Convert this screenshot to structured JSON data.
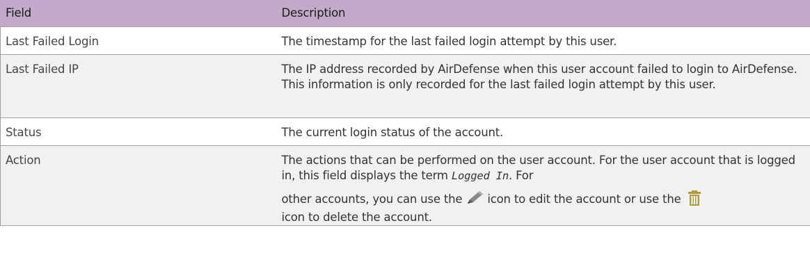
{
  "table": {
    "headers": [
      "Field",
      "Description"
    ],
    "rows": [
      {
        "field": "Last Failed Login",
        "description": "The timestamp for the last failed login attempt by this user."
      },
      {
        "field": "Last Failed IP",
        "description": "The IP address recorded by AirDefense when this user account failed to login to AirDefense. This information is only recorded for the last failed login attempt by this user."
      },
      {
        "field": "Status",
        "description": "The current login status of the account."
      },
      {
        "field": "Action",
        "description_part1": "The actions that can be performed on the user account. For the user account that is logged in, this field displays the term ",
        "term": "Logged In",
        "description_part2": ". For",
        "description_part3": "other accounts, you can use the ",
        "edit_icon": "pencil-icon",
        "description_part4": " icon to edit the account or use the ",
        "delete_icon": "trash-icon",
        "description_part5": "icon to delete the account."
      }
    ]
  },
  "colors": {
    "header_background": "#c3aacb",
    "alt_row_background": "#f1f1f1",
    "border": "#9e9e9e",
    "pencil": "#777777",
    "trash": "#b39a40"
  }
}
